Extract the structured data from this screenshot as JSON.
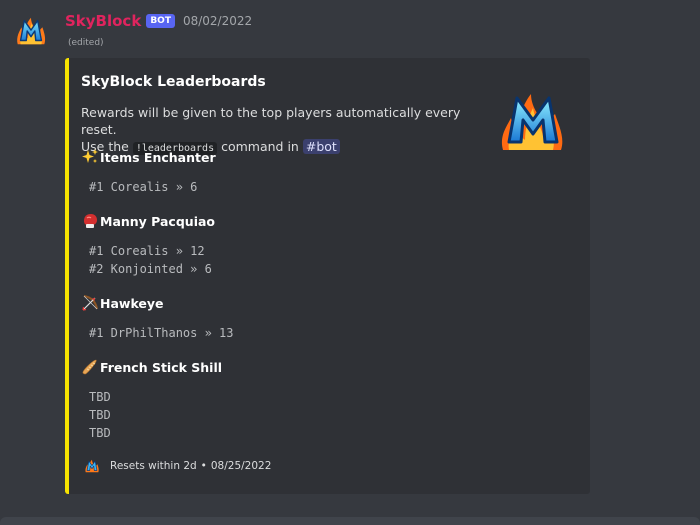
{
  "message": {
    "username": "SkyBlock",
    "bot_tag": "BOT",
    "timestamp": "08/02/2022",
    "edited": "(edited)"
  },
  "embed": {
    "color": "#f7e300",
    "title": "SkyBlock Leaderboards",
    "description": {
      "line1": "Rewards will be given to the top players automatically every reset.",
      "line2_prefix": "Use the",
      "command": "!leaderboards",
      "line2_mid": "command in",
      "channel_hash": "#",
      "channel": "bot"
    },
    "fields": [
      {
        "name": "Items Enchanter",
        "icon": "sparkles-icon",
        "lines": [
          "#1 Corealis » 6"
        ]
      },
      {
        "name": "Manny Pacquiao",
        "icon": "boxing-glove-icon",
        "lines": [
          "#1 Corealis » 12",
          "#2 Konjointed » 6"
        ]
      },
      {
        "name": "Hawkeye",
        "icon": "bow-and-arrow-icon",
        "lines": [
          "#1 DrPhilThanos » 13"
        ]
      },
      {
        "name": "French Stick Shill",
        "icon": "baguette-icon",
        "lines": [
          "TBD",
          "TBD",
          "TBD"
        ]
      }
    ],
    "footer": {
      "text": "Resets within 2d",
      "separator": "•",
      "date": "08/25/2022"
    }
  },
  "colors": {
    "username": "#e0245e",
    "bot_tag": "#5865f2",
    "embed_bar": "#f7e300",
    "background": "#36393f",
    "embed_bg": "#2f3136"
  }
}
